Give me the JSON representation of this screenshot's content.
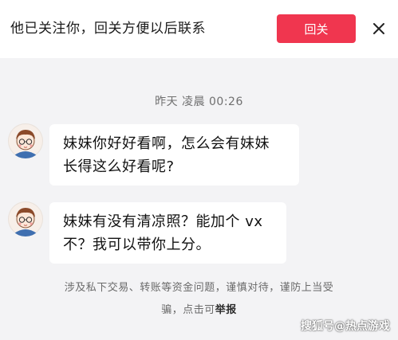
{
  "topbar": {
    "prompt_text": "他已关注你，回关方便以后联系",
    "follow_back_label": "回关",
    "close_icon": "close-icon"
  },
  "conversation": {
    "timestamp": "昨天 凌晨 00:26",
    "messages": [
      {
        "avatar_icon": "cartoon-avatar-icon",
        "lines": [
          "妹妹你好好看啊，怎么会有妹妹",
          "长得这么好看呢?"
        ]
      },
      {
        "avatar_icon": "cartoon-avatar-icon",
        "lines": [
          "妹妹有没有清凉照？能加个 vx",
          "不？我可以带你上分。"
        ]
      }
    ]
  },
  "notice": {
    "line1": "涉及私下交易、转账等资金问题，谨慎对待，谨防上当受",
    "line2_prefix": "骗，点击可",
    "report_link": "举报"
  },
  "watermark": "搜狐号@热点游戏",
  "colors": {
    "accent": "#f0364f",
    "background": "#f3f3f5",
    "bubble": "#ffffff"
  }
}
